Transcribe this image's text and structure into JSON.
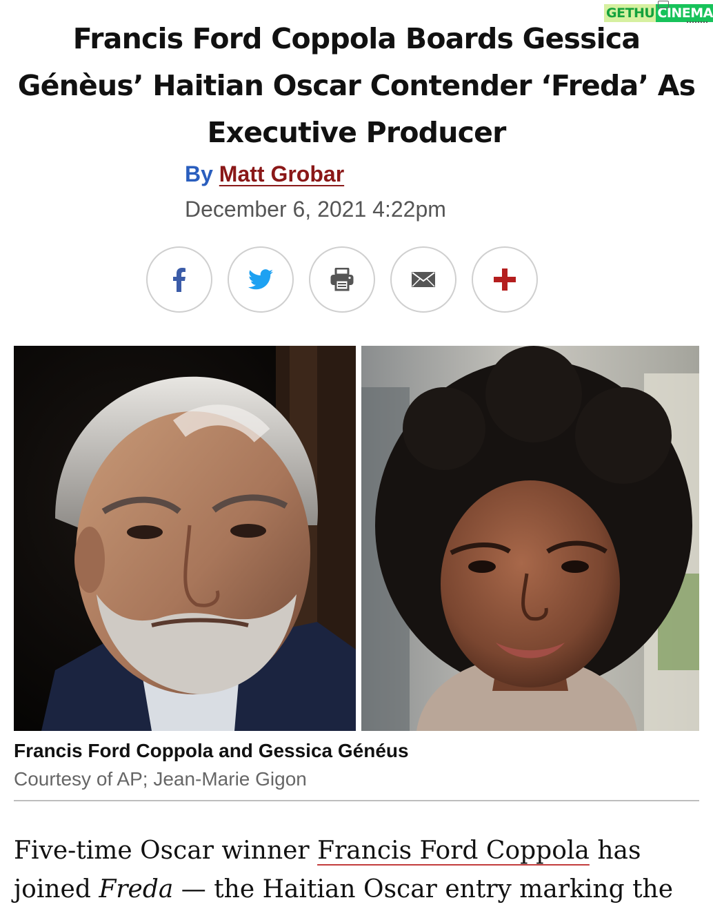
{
  "watermark": {
    "part1": "GETHU",
    "part2": "CINEMA"
  },
  "article": {
    "headline": "Francis Ford Coppola Boards Gessica Génèus’ Haitian Oscar Contender ‘Freda’ As Executive Producer",
    "byline_prefix": "By",
    "author": "Matt Grobar",
    "date": "December 6, 2021 4:22pm"
  },
  "share": [
    {
      "icon": "facebook-icon"
    },
    {
      "icon": "twitter-icon"
    },
    {
      "icon": "print-icon"
    },
    {
      "icon": "email-icon"
    },
    {
      "icon": "plus-icon"
    }
  ],
  "photo": {
    "caption": "Francis Ford Coppola and Gessica Généus",
    "credit": "Courtesy of AP; Jean-Marie Gigon"
  },
  "body": {
    "p1_start": "Five-time Oscar winner ",
    "p1_link": "Francis Ford Coppola",
    "p1_mid": " has joined ",
    "p1_italic": "Freda",
    "p1_end": " — the Haitian Oscar entry marking the"
  },
  "colors": {
    "byline_blue": "#2a5ebe",
    "author_red": "#8a1818",
    "facebook_blue": "#3b5ca8",
    "twitter_blue": "#1da1f2",
    "plus_red": "#b41e1e",
    "link_underline": "#c23b3b"
  }
}
